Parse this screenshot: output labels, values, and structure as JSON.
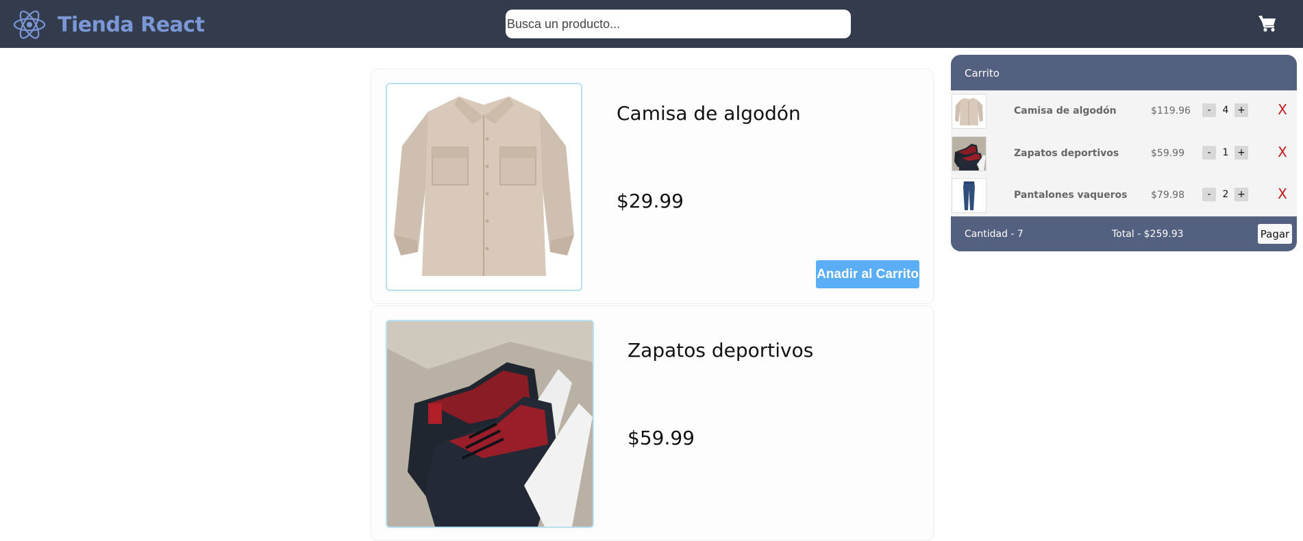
{
  "header": {
    "brand_title": "Tienda React",
    "search_placeholder": "Busca un producto...",
    "brand_color": "#7c97d6",
    "bar_color": "#333c4d",
    "cart_icon": "shopping-cart-icon",
    "brand_icon": "react-atom-icon"
  },
  "products": [
    {
      "name": "Camisa de algodón",
      "price": "$29.99",
      "add_label": "Anadir al Carrito"
    },
    {
      "name": "Zapatos deportivos",
      "price": "$59.99"
    }
  ],
  "cart": {
    "title": "Carrito",
    "items": [
      {
        "name": "Camisa de algodón",
        "price": "$119.96",
        "quantity": "4",
        "minus": "-",
        "plus": "+",
        "remove": "X"
      },
      {
        "name": "Zapatos deportivos",
        "price": "$59.99",
        "quantity": "1",
        "minus": "-",
        "plus": "+",
        "remove": "X"
      },
      {
        "name": "Pantalones vaqueros",
        "price": "$79.98",
        "quantity": "2",
        "minus": "-",
        "plus": "+",
        "remove": "X"
      }
    ],
    "quantity_label": "Cantidad - 7",
    "total_label": "Total - $259.93",
    "pay_label": "Pagar",
    "panel_color": "#536080",
    "remove_color": "#c0161e"
  },
  "colors": {
    "add_button": "#5aaef5",
    "image_border": "#b7e0f2"
  }
}
